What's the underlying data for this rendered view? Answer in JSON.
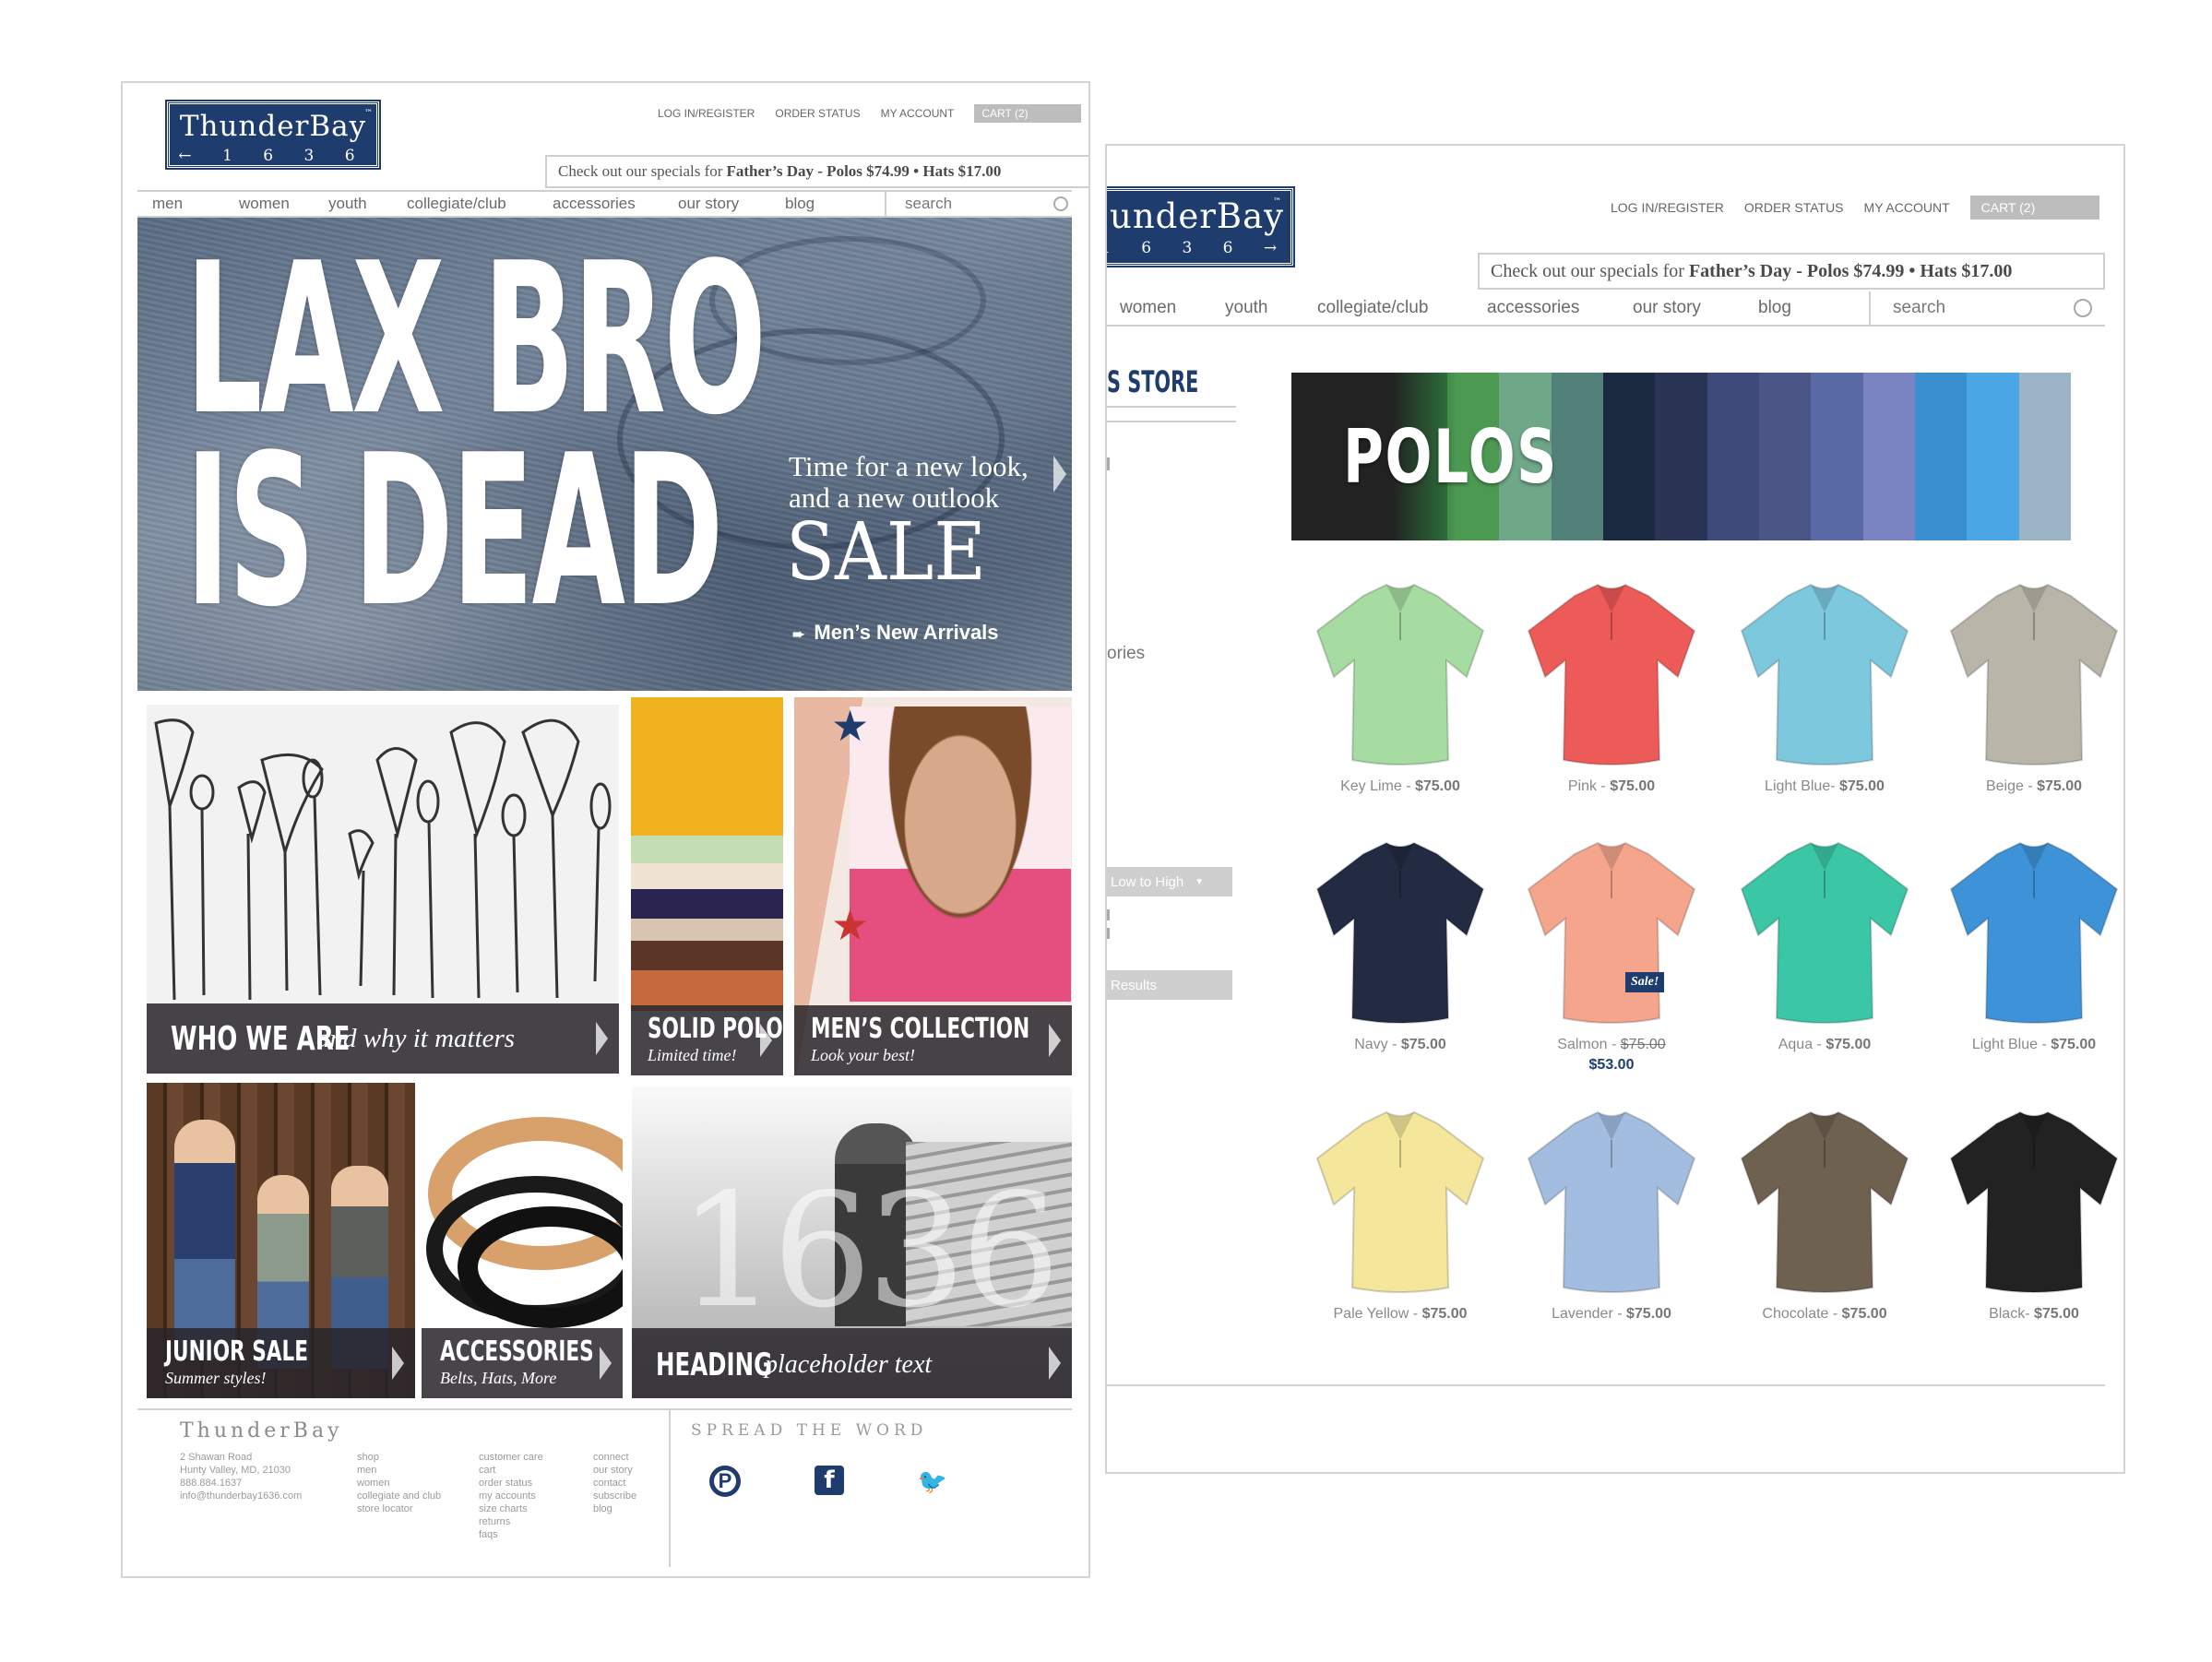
{
  "home": {
    "logo": {
      "title": "ThunderBay",
      "sub": "1 6 3 6",
      "tm": "™"
    },
    "utility": {
      "login": "LOG IN/REGISTER",
      "order": "ORDER STATUS",
      "account": "MY ACCOUNT",
      "cart": "CART (2)"
    },
    "promo": {
      "text": "Check out our specials for ",
      "bold": "Father’s Day - Polos $74.99 • Hats $17.00"
    },
    "nav": [
      "men",
      "women",
      "youth",
      "collegiate/club",
      "accessories",
      "our story",
      "blog"
    ],
    "search_placeholder": "search",
    "hero": {
      "line1": "LAX BRO",
      "line2": "IS DEAD",
      "sub1": "Time for a new look,",
      "sub2": "and a new outlook",
      "sale": "SALE",
      "link": "Men’s New Arrivals"
    },
    "tiles": [
      {
        "title": "WHO WE ARE",
        "sub": "and why it matters"
      },
      {
        "title": "SOLID POLO",
        "sub": "Limited time!"
      },
      {
        "title": "MEN’S COLLECTION",
        "sub": "Look your best!"
      },
      {
        "title": "JUNIOR SALE",
        "sub": "Summer styles!"
      },
      {
        "title": "ACCESSORIES",
        "sub": "Belts, Hats, More"
      },
      {
        "title": "HEADING",
        "sub": "placeholder text"
      }
    ],
    "footer": {
      "brand": "ThunderBay",
      "address": [
        "2 Shawan Road",
        "Hunty Valley, MD, 21030",
        "888.884.1637",
        "info@thunderbay1636.com"
      ],
      "shop": [
        "shop",
        "men",
        "women",
        "collegiate and club",
        "store locator"
      ],
      "care": [
        "customer care",
        "cart",
        "order status",
        "my accounts",
        "size charts",
        "returns",
        "faqs"
      ],
      "connect": [
        "connect",
        "our story",
        "contact",
        "subscribe",
        "blog"
      ],
      "spread": "SPREAD THE WORD"
    },
    "social": [
      {
        "name": "pinterest-icon",
        "glyph": "P"
      },
      {
        "name": "facebook-icon",
        "glyph": "f"
      },
      {
        "name": "twitter-icon",
        "glyph": "🐦"
      }
    ]
  },
  "category": {
    "logo": {
      "title": "underBay",
      "sub": "1 6 3 6",
      "tm": "™"
    },
    "utility": {
      "login": "LOG IN/REGISTER",
      "order": "ORDER STATUS",
      "account": "MY ACCOUNT",
      "cart": "CART (2)"
    },
    "promo": {
      "text": "Check out our specials for ",
      "bold": "Father’s Day - Polos $74.99 • Hats $17.00"
    },
    "nav": [
      "women",
      "youth",
      "collegiate/club",
      "accessories",
      "our story",
      "blog"
    ],
    "search_placeholder": "search",
    "sidebar": {
      "heading": "S STORE",
      "ories": "ories",
      "sort": "Low to High",
      "results": "Results"
    },
    "banner_title": "POLOS",
    "products": [
      {
        "name": "Key Lime",
        "sep": " - ",
        "price": "$75.00",
        "color": "#a6dba2"
      },
      {
        "name": "Pink",
        "sep": " - ",
        "price": "$75.00",
        "color": "#ec5b57"
      },
      {
        "name": "Light Blue",
        "sep": "- ",
        "price": "$75.00",
        "color": "#7ec8de"
      },
      {
        "name": "Beige",
        "sep": " - ",
        "price": "$75.00",
        "color": "#b9b5a9"
      },
      {
        "name": "Navy",
        "sep": " - ",
        "price": "$75.00",
        "color": "#232b42"
      },
      {
        "name": "Salmon",
        "sep": " - ",
        "price": "$75.00",
        "sale_price": "$53.00",
        "sale_tag": "Sale!",
        "color": "#f4a58c"
      },
      {
        "name": "Aqua",
        "sep": " - ",
        "price": "$75.00",
        "color": "#3bc6a5"
      },
      {
        "name": "Light Blue",
        "sep": " - ",
        "price": "$75.00",
        "color": "#3e93d8"
      },
      {
        "name": "Pale Yellow",
        "sep": " - ",
        "price": "$75.00",
        "color": "#f4e79c"
      },
      {
        "name": "Lavender",
        "sep": " - ",
        "price": "$75.00",
        "color": "#a3bde0"
      },
      {
        "name": "Chocolate",
        "sep": " - ",
        "price": "$75.00",
        "color": "#6f6150"
      },
      {
        "name": "Black",
        "sep": "- ",
        "price": "$75.00",
        "color": "#222222"
      }
    ]
  }
}
